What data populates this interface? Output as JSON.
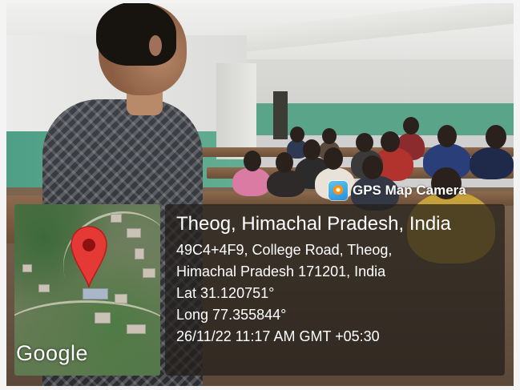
{
  "overlay": {
    "app_name": "GPS Map Camera",
    "app_icon": "gps-map-camera-icon",
    "map_attribution": "Google",
    "location_title": "Theog, Himachal Pradesh, India",
    "address_line_1": "49C4+4F9, College Road, Theog,",
    "address_line_2": "Himachal Pradesh 171201, India",
    "latitude": "Lat 31.120751°",
    "longitude": "Long 77.355844°",
    "datetime": "26/11/22 11:17 AM GMT +05:30"
  },
  "colors": {
    "pin": "#e53935",
    "wall_green": "#5aa58a",
    "info_bg": "rgba(35,30,26,0.72)"
  }
}
